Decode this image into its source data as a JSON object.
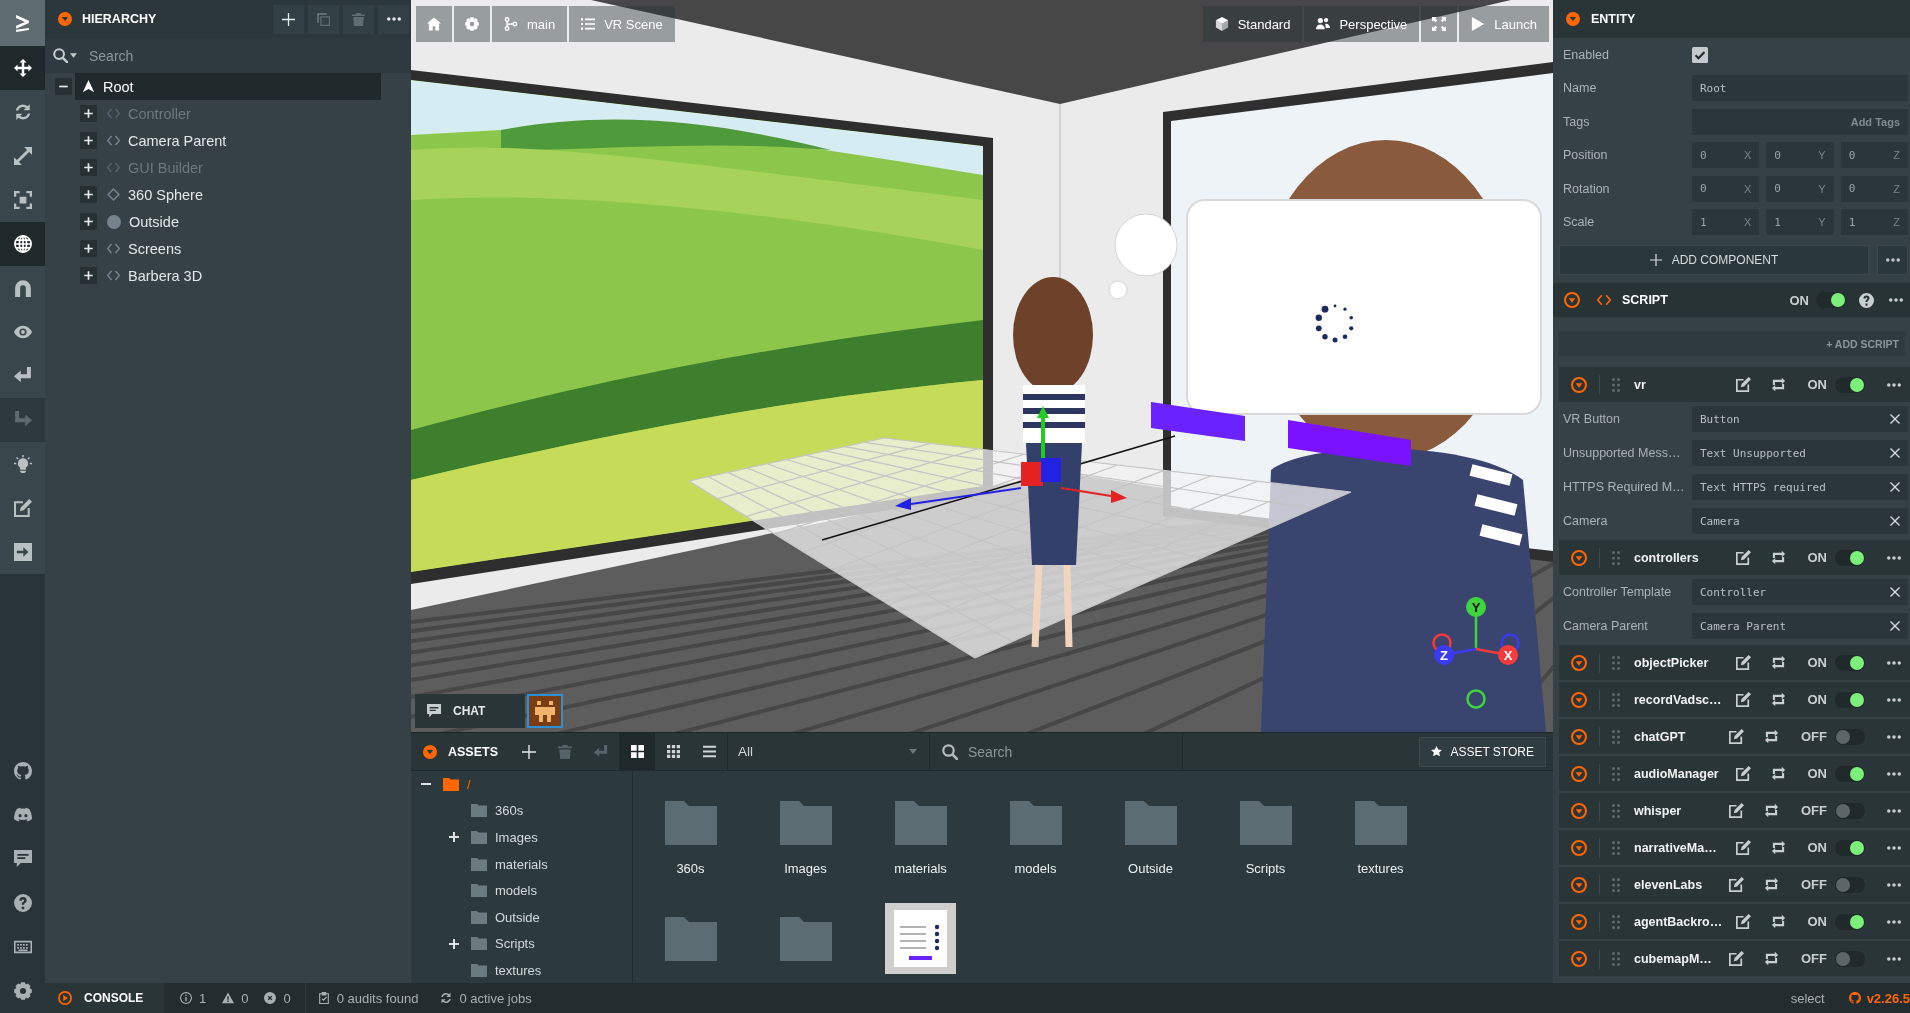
{
  "toolbar": {
    "tools": [
      {
        "selected": true,
        "disabled": false
      },
      {
        "selected": false,
        "disabled": false
      },
      {
        "selected": false,
        "disabled": false
      },
      {
        "selected": false,
        "disabled": false
      },
      {
        "selected": true,
        "disabled": false
      },
      {
        "selected": false,
        "disabled": false
      },
      {
        "selected": false,
        "disabled": false
      },
      {
        "selected": false,
        "disabled": false
      },
      {
        "selected": false,
        "disabled": true
      },
      {
        "selected": false,
        "disabled": false
      },
      {
        "selected": false,
        "disabled": false
      },
      {
        "selected": false,
        "disabled": false
      }
    ]
  },
  "hierarchy": {
    "title": "HIERARCHY",
    "actions": [
      {
        "disabled": false
      },
      {
        "disabled": true
      },
      {
        "disabled": true
      },
      {
        "disabled": false
      }
    ],
    "search": {
      "placeholder": "Search"
    },
    "tree": [
      {
        "label": "Root",
        "kind": "root",
        "selected": true,
        "enabled": true,
        "expanded": true,
        "children": [
          {
            "label": "Controller",
            "kind": "script",
            "selected": false,
            "enabled": false,
            "expanded": false
          },
          {
            "label": "Camera Parent",
            "kind": "script",
            "selected": false,
            "enabled": true,
            "expanded": false
          },
          {
            "label": "GUI Builder",
            "kind": "script",
            "selected": false,
            "enabled": false,
            "expanded": false
          },
          {
            "label": "360 Sphere",
            "kind": "model",
            "selected": false,
            "enabled": true,
            "expanded": false
          },
          {
            "label": "Outside",
            "kind": "sphere",
            "selected": false,
            "enabled": true,
            "expanded": false
          },
          {
            "label": "Screens",
            "kind": "script",
            "selected": false,
            "enabled": true,
            "expanded": false
          },
          {
            "label": "Barbera 3D",
            "kind": "script",
            "selected": false,
            "enabled": true,
            "expanded": false
          }
        ]
      }
    ]
  },
  "viewport": {
    "left_buttons": [
      {
        "kind": "home"
      },
      {
        "kind": "settings"
      },
      {
        "kind": "branch",
        "label": "main"
      },
      {
        "kind": "scene",
        "label": "VR Scene"
      }
    ],
    "right_buttons": [
      {
        "kind": "render-mode",
        "label": "Standard"
      },
      {
        "kind": "camera",
        "label": "Perspective"
      },
      {
        "kind": "fullscreen"
      },
      {
        "kind": "launch",
        "label": "Launch"
      }
    ],
    "chat": {
      "label": "CHAT"
    },
    "axes": [
      {
        "label": "Y",
        "color": "#3fd43f"
      },
      {
        "label": "Z",
        "color": "#3b3bf5"
      },
      {
        "label": "X",
        "color": "#f53b3b"
      }
    ]
  },
  "assets": {
    "title": "ASSETS",
    "actions": [
      {
        "disabled": false
      },
      {
        "disabled": true
      },
      {
        "disabled": true
      }
    ],
    "view_modes": [
      {
        "selected": true
      },
      {
        "selected": false
      },
      {
        "selected": false
      }
    ],
    "filter": {
      "value": "All"
    },
    "search": {
      "placeholder": "Search"
    },
    "store_button": "ASSET STORE",
    "tree": [
      {
        "label": "/",
        "selected": true,
        "expanded": true,
        "children": [
          {
            "label": "360s",
            "selected": false
          },
          {
            "label": "Images",
            "selected": false,
            "expanded": false
          },
          {
            "label": "materials",
            "selected": false
          },
          {
            "label": "models",
            "selected": false
          },
          {
            "label": "Outside",
            "selected": false
          },
          {
            "label": "Scripts",
            "selected": false,
            "expanded": false
          },
          {
            "label": "textures",
            "selected": false
          }
        ]
      }
    ],
    "items": [
      {
        "kind": "folder",
        "label": "360s"
      },
      {
        "kind": "folder",
        "label": "Images"
      },
      {
        "kind": "folder",
        "label": "materials"
      },
      {
        "kind": "folder",
        "label": "models"
      },
      {
        "kind": "folder",
        "label": "Outside"
      },
      {
        "kind": "folder",
        "label": "Scripts"
      },
      {
        "kind": "folder",
        "label": "textures"
      },
      {
        "kind": "folder"
      },
      {
        "kind": "folder"
      },
      {
        "kind": "image"
      }
    ]
  },
  "inspector": {
    "title": "ENTITY",
    "fields": [
      {
        "kind": "checkbox",
        "label": "Enabled",
        "checked": true
      },
      {
        "kind": "text",
        "label": "Name",
        "value": "Root"
      },
      {
        "kind": "tags",
        "label": "Tags",
        "placeholder": "Add Tags"
      },
      {
        "kind": "vector",
        "label": "Position",
        "values": [
          {
            "value": "0",
            "axis": "X"
          },
          {
            "value": "0",
            "axis": "Y"
          },
          {
            "value": "0",
            "axis": "Z"
          }
        ]
      },
      {
        "kind": "vector",
        "label": "Rotation",
        "values": [
          {
            "value": "0",
            "axis": "X"
          },
          {
            "value": "0",
            "axis": "Y"
          },
          {
            "value": "0",
            "axis": "Z"
          }
        ]
      },
      {
        "kind": "vector",
        "label": "Scale",
        "values": [
          {
            "value": "1",
            "axis": "X"
          },
          {
            "value": "1",
            "axis": "Y"
          },
          {
            "value": "1",
            "axis": "Z"
          }
        ]
      }
    ],
    "add_component": "ADD COMPONENT",
    "script": {
      "title": "SCRIPT",
      "on": true,
      "state_label": "ON",
      "add_script": "+ ADD SCRIPT",
      "scripts": [
        {
          "name": "vr",
          "on": true,
          "state_label": "ON",
          "attributes": [
            {
              "label": "VR Button",
              "value": "Button"
            },
            {
              "label": "Unsupported Mess…",
              "value": "Text Unsupported"
            },
            {
              "label": "HTTPS Required M…",
              "value": "Text HTTPS required"
            },
            {
              "label": "Camera",
              "value": "Camera"
            }
          ]
        },
        {
          "name": "controllers",
          "on": true,
          "state_label": "ON",
          "attributes": [
            {
              "label": "Controller Template",
              "value": "Controller"
            },
            {
              "label": "Camera Parent",
              "value": "Camera Parent"
            }
          ]
        },
        {
          "name": "objectPicker",
          "on": true,
          "state_label": "ON"
        },
        {
          "name": "recordVadsc…",
          "on": true,
          "state_label": "ON"
        },
        {
          "name": "chatGPT",
          "on": false,
          "state_label": "OFF"
        },
        {
          "name": "audioManager",
          "on": true,
          "state_label": "ON"
        },
        {
          "name": "whisper",
          "on": false,
          "state_label": "OFF"
        },
        {
          "name": "narrativeMa…",
          "on": true,
          "state_label": "ON"
        },
        {
          "name": "elevenLabs",
          "on": false,
          "state_label": "OFF"
        },
        {
          "name": "agentBackro…",
          "on": true,
          "state_label": "ON"
        },
        {
          "name": "cubemapM…",
          "on": false,
          "state_label": "OFF"
        }
      ]
    }
  },
  "status_bar": {
    "console": "CONSOLE",
    "counts": [
      {
        "kind": "info",
        "value": "1"
      },
      {
        "kind": "warning",
        "value": "0"
      },
      {
        "kind": "error",
        "value": "0"
      }
    ],
    "audits": "0 audits found",
    "jobs": "0 active jobs",
    "mode": "select",
    "version": "v2.26.5"
  }
}
